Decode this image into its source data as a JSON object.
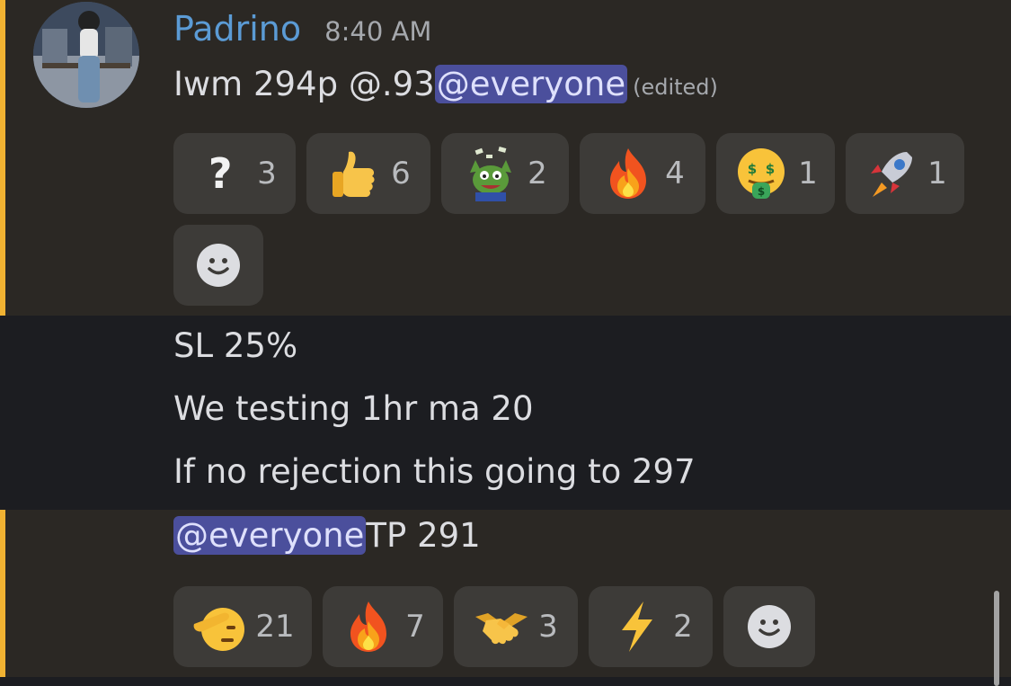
{
  "message1": {
    "username": "Padrino",
    "timestamp": "8:40 AM",
    "text": "Iwm 294p @.93 ",
    "mention": "@everyone",
    "edited": "(edited)",
    "reactions": [
      {
        "icon": "question-mark-icon",
        "count": "3"
      },
      {
        "icon": "thumbs-up-icon",
        "count": "6"
      },
      {
        "icon": "pepe-money-icon",
        "count": "2"
      },
      {
        "icon": "fire-icon",
        "count": "4"
      },
      {
        "icon": "money-mouth-face-icon",
        "count": "1"
      },
      {
        "icon": "rocket-icon",
        "count": "1"
      }
    ]
  },
  "message2": {
    "line1": "SL 25%",
    "line2": "We testing 1hr ma 20",
    "line3": "If no rejection this going to 297"
  },
  "message3": {
    "mention": "@everyone",
    "text": " TP 291",
    "reactions": [
      {
        "icon": "saluting-face-icon",
        "count": "21"
      },
      {
        "icon": "fire-icon",
        "count": "7"
      },
      {
        "icon": "handshake-icon",
        "count": "3"
      },
      {
        "icon": "lightning-icon",
        "count": "2"
      }
    ]
  },
  "colors": {
    "accent": "#f0b232",
    "username": "#5b9bd5",
    "mention_bg": "#4b4f9c",
    "reaction_bg": "#3d3b38"
  }
}
